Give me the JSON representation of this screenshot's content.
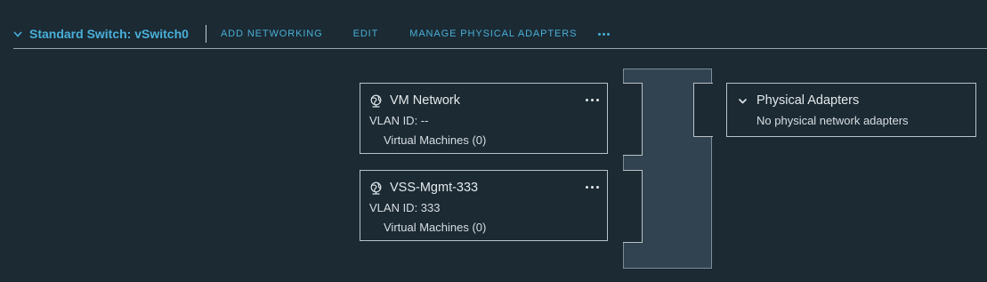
{
  "header": {
    "title": "Standard Switch: vSwitch0",
    "actions": {
      "add_networking": "ADD NETWORKING",
      "edit": "EDIT",
      "manage_physical_adapters": "MANAGE PHYSICAL ADAPTERS"
    },
    "more_icon": "more-horizontal-icon",
    "collapse_icon": "chevron-down-icon"
  },
  "port_groups": [
    {
      "name": "VM Network",
      "vlan": "VLAN ID: --",
      "vms": "Virtual Machines (0)",
      "icon": "network-globe-icon"
    },
    {
      "name": "VSS-Mgmt-333",
      "vlan": "VLAN ID: 333",
      "vms": "Virtual Machines (0)",
      "icon": "network-globe-icon"
    }
  ],
  "physical_adapters": {
    "title": "Physical Adapters",
    "status": "No physical network adapters",
    "icon": "chevron-down-icon"
  },
  "colors": {
    "background": "#1b2a33",
    "accent": "#49afd9",
    "switch_body": "#314350",
    "border": "#b9c2c7"
  }
}
